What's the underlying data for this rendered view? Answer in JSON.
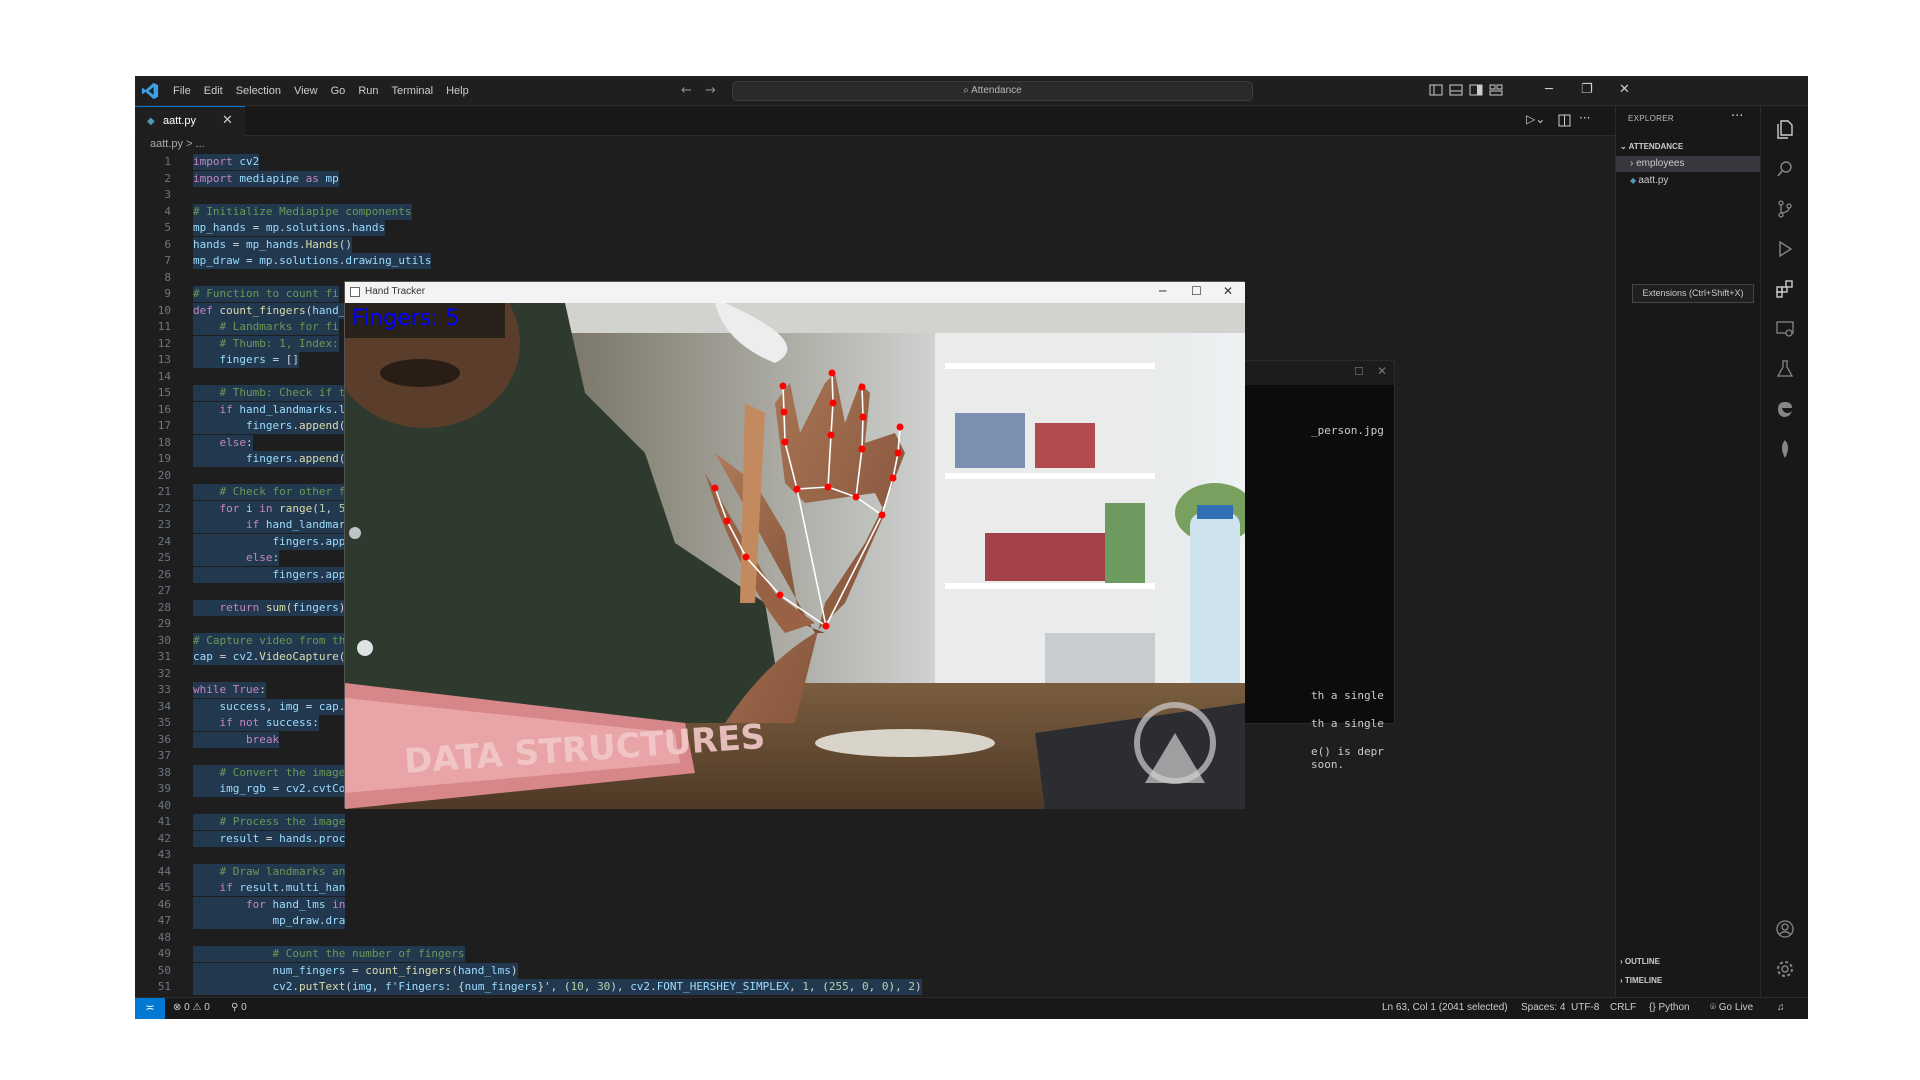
{
  "menu": [
    "File",
    "Edit",
    "Selection",
    "View",
    "Go",
    "Run",
    "Terminal",
    "Help"
  ],
  "command_center": "Attendance",
  "tab": {
    "filename": "aatt.py",
    "close": "✕"
  },
  "breadcrumb": "aatt.py > ...",
  "code_lines": [
    {
      "n": "1",
      "t": "import cv2"
    },
    {
      "n": "2",
      "t": "import mediapipe as mp"
    },
    {
      "n": "3",
      "t": ""
    },
    {
      "n": "4",
      "t": "# Initialize Mediapipe components"
    },
    {
      "n": "5",
      "t": "mp_hands = mp.solutions.hands"
    },
    {
      "n": "6",
      "t": "hands = mp_hands.Hands()"
    },
    {
      "n": "7",
      "t": "mp_draw = mp.solutions.drawing_utils"
    },
    {
      "n": "8",
      "t": ""
    },
    {
      "n": "9",
      "t": "# Function to count fi"
    },
    {
      "n": "10",
      "t": "def count_fingers(hand_"
    },
    {
      "n": "11",
      "t": "    # Landmarks for fi"
    },
    {
      "n": "12",
      "t": "    # Thumb: 1, Index:"
    },
    {
      "n": "13",
      "t": "    fingers = []"
    },
    {
      "n": "14",
      "t": ""
    },
    {
      "n": "15",
      "t": "    # Thumb: Check if t"
    },
    {
      "n": "16",
      "t": "    if hand_landmarks.l"
    },
    {
      "n": "17",
      "t": "        fingers.append("
    },
    {
      "n": "18",
      "t": "    else:"
    },
    {
      "n": "19",
      "t": "        fingers.append("
    },
    {
      "n": "20",
      "t": ""
    },
    {
      "n": "21",
      "t": "    # Check for other f"
    },
    {
      "n": "22",
      "t": "    for i in range(1, 5"
    },
    {
      "n": "23",
      "t": "        if hand_landmar"
    },
    {
      "n": "24",
      "t": "            fingers.app"
    },
    {
      "n": "25",
      "t": "        else:"
    },
    {
      "n": "26",
      "t": "            fingers.app"
    },
    {
      "n": "27",
      "t": ""
    },
    {
      "n": "28",
      "t": "    return sum(fingers)"
    },
    {
      "n": "29",
      "t": ""
    },
    {
      "n": "30",
      "t": "# Capture video from th"
    },
    {
      "n": "31",
      "t": "cap = cv2.VideoCapture("
    },
    {
      "n": "32",
      "t": ""
    },
    {
      "n": "33",
      "t": "while True:"
    },
    {
      "n": "34",
      "t": "    success, img = cap."
    },
    {
      "n": "35",
      "t": "    if not success:"
    },
    {
      "n": "36",
      "t": "        break"
    },
    {
      "n": "37",
      "t": ""
    },
    {
      "n": "38",
      "t": "    # Convert the image"
    },
    {
      "n": "39",
      "t": "    img_rgb = cv2.cvtCo"
    },
    {
      "n": "40",
      "t": ""
    },
    {
      "n": "41",
      "t": "    # Process the image"
    },
    {
      "n": "42",
      "t": "    result = hands.proc"
    },
    {
      "n": "43",
      "t": ""
    },
    {
      "n": "44",
      "t": "    # Draw landmarks an"
    },
    {
      "n": "45",
      "t": "    if result.multi_han"
    },
    {
      "n": "46",
      "t": "        for hand_lms in"
    },
    {
      "n": "47",
      "t": "            mp_draw.dra"
    },
    {
      "n": "48",
      "t": ""
    },
    {
      "n": "49",
      "t": "            # Count the number of fingers"
    },
    {
      "n": "50",
      "t": "            num_fingers = count_fingers(hand_lms)"
    },
    {
      "n": "51",
      "t": "            cv2.putText(img, f'Fingers: {num_fingers}', (10, 30), cv2.FONT_HERSHEY_SIMPLEX, 1, (255, 0, 0), 2)"
    }
  ],
  "hand_tracker": {
    "title": "Hand Tracker",
    "overlay_text": "Fingers: 5",
    "book_text": "DATA STRUCTURES"
  },
  "terminal_lines": [
    "_person.jpg",
    "th a single",
    "th a single",
    "e() is depr",
    "soon."
  ],
  "explorer": {
    "header": "EXPLORER",
    "more": "···",
    "section": "ATTENDANCE",
    "items": [
      "employees",
      "aatt.py"
    ],
    "outline": "OUTLINE",
    "timeline": "TIMELINE"
  },
  "tooltip": "Extensions (Ctrl+Shift+X)",
  "status": {
    "errors": "0",
    "warnings": "0",
    "ports": "0",
    "position": "Ln 63, Col 1 (2041 selected)",
    "spaces": "Spaces: 4",
    "encoding": "UTF-8",
    "eol": "CRLF",
    "language": "Python",
    "golive": "Go Live"
  },
  "colors": {
    "accent": "#0078d4",
    "editor_bg": "#1e1e1e",
    "overlay_text": "#0000ff",
    "landmark": "#ff0000"
  },
  "icons": [
    "vscode-logo-icon",
    "explorer-icon",
    "search-icon",
    "source-control-icon",
    "run-debug-icon",
    "extensions-icon",
    "remote-explorer-icon",
    "testing-icon",
    "edge-icon",
    "mongodb-icon",
    "account-icon",
    "settings-icon"
  ]
}
